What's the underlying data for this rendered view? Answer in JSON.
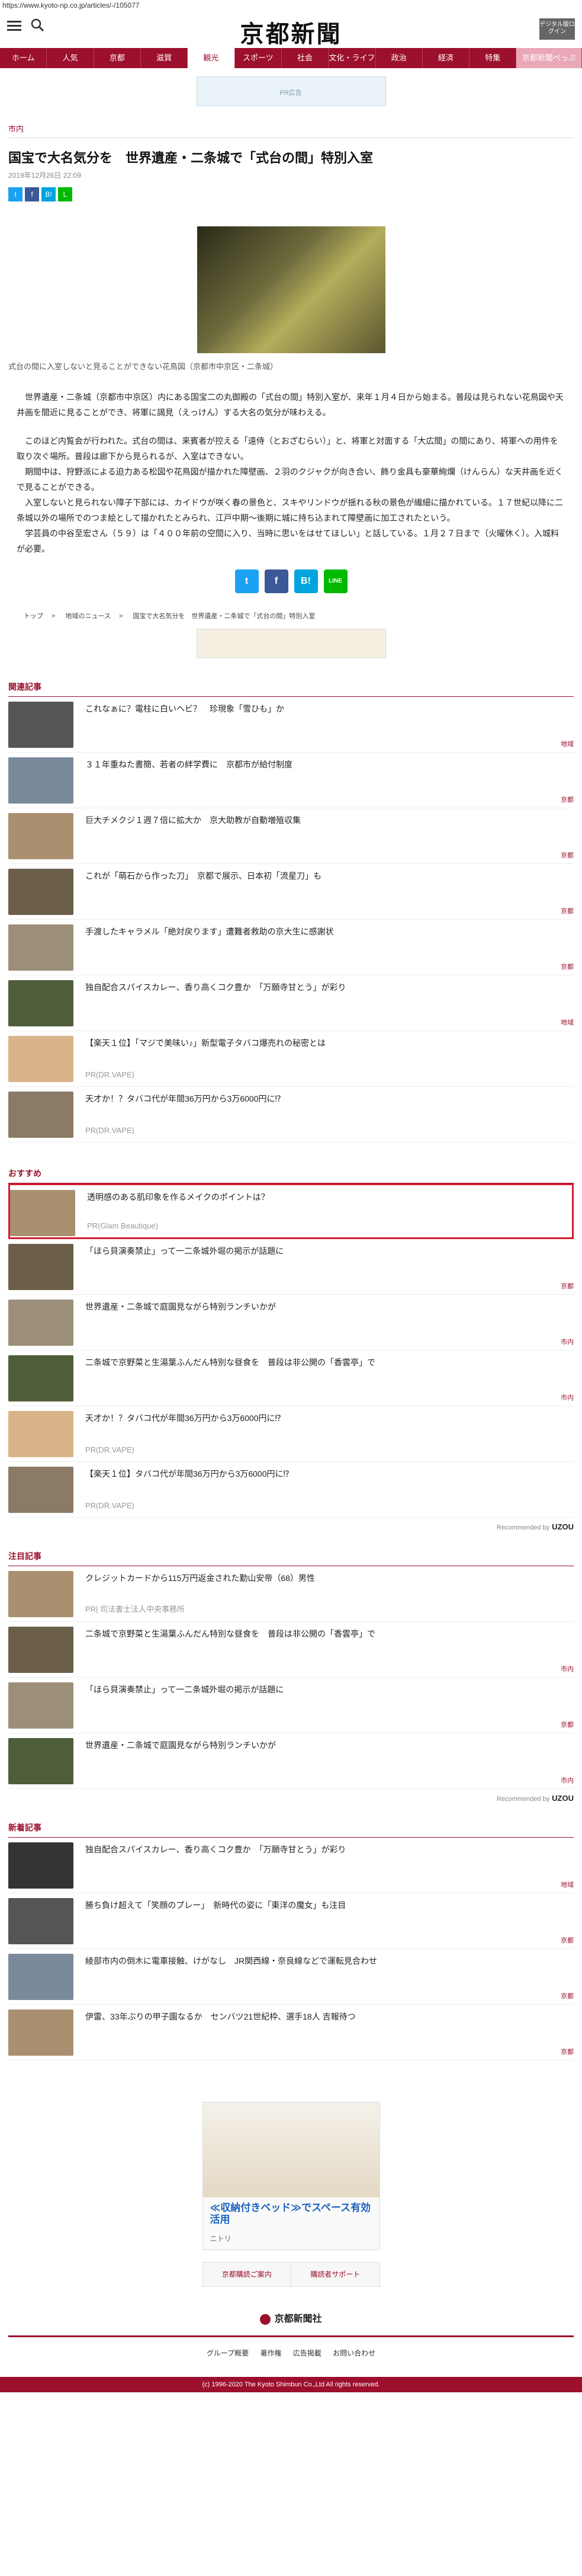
{
  "url": "https://www.kyoto-np.co.jp/articles/-/105077",
  "site": {
    "logo_text": "京都新聞",
    "digital_btn": "デジタル版ログイン",
    "brand_color": "#9c0f2d"
  },
  "nav": [
    "ホーム",
    "人気",
    "京都",
    "滋賀",
    "観光",
    "スポーツ",
    "社会",
    "文化・ライフ",
    "政治",
    "経済",
    "特集",
    "京都新聞ぺっぷ"
  ],
  "nav_active": 4,
  "ad_top_text": "PR広告",
  "article": {
    "section": "市内",
    "title": "国宝で大名気分を　世界遺産・二条城で「式台の間」特別入室",
    "date": "2019年12月26日 22:09",
    "caption": "式台の間に入室しないと見ることができない花鳥図（京都市中京区・二条城）",
    "paragraphs": [
      "　世界遺産・二条城（京都市中京区）内にある国宝二の丸御殿の「式台の間」特別入室が、来年１月４日から始まる。普段は見られない花鳥図や天井画を間近に見ることができ、将軍に謁見（えっけん）する大名の気分が味わえる。",
      "　このほど内覧会が行われた。式台の間は、来賓者が控える「遠侍（とおざむらい）」と、将軍と対面する「大広間」の間にあり、将軍への用件を取り次ぐ場所。普段は廊下から見られるが、入室はできない。\n　期間中は、狩野派による迫力ある松図や花鳥図が描かれた障壁画、２羽のクジャクが向き合い、飾り金具も豪華絢爛（けんらん）な天井画を近くで見ることができる。\n　入室しないと見られない障子下部には、カイドウが咲く春の景色と、スキやリンドウが揺れる秋の景色が繊細に描かれている。１７世紀以降に二条城以外の場所でのつま絵として描かれたとみられ、江戸中期～後期に城に持ち込まれて障壁画に加工されたという。\n　学芸員の中谷至宏さん（５９）は「４００年前の空間に入り、当時に思いをはせてほしい」と話している。１月２７日まで（火曜休く）。入城料が必要。"
    ]
  },
  "share": {
    "twitter": "t",
    "facebook": "f",
    "hatena": "B!",
    "line": "LINE"
  },
  "breadcrumb": [
    "トップ",
    "地域のニュース",
    "国宝で大名気分を　世界遺産・二条城で「式台の間」特別入室"
  ],
  "related": {
    "title": "関連記事",
    "items": [
      {
        "title": "これなぁに？電柱に白いヘビ？　珍現象「雪ひも」か",
        "cat": "地域"
      },
      {
        "title": "３１年重ねた書簡、若者の絆学費に　京都市が給付制度",
        "cat": "京都"
      },
      {
        "title": "巨大チメクジ１週７倍に拡大か　京大助教が自動増殖収集",
        "cat": "京都"
      },
      {
        "title": "これが「萌石から作った刀」　京都で展示、日本初「流星刀」も",
        "cat": "京都"
      },
      {
        "title": "手渡したキャラメル「絶対戻ります」遭難者救助の京大生に感謝状",
        "cat": "京都"
      },
      {
        "title": "独自配合スパイスカレー、香り高くコク豊か　「万願寺甘とう」が彩り",
        "cat": "地域"
      },
      {
        "title": "【楽天１位】「マジで美味い♪」新型電子タバコ爆売れの秘密とは",
        "pr": "PR(DR.VAPE)"
      },
      {
        "title": "天才か！？タバコ代が年間36万円から3万6000円に⁉",
        "pr": "PR(DR.VAPE)"
      }
    ]
  },
  "recommend": {
    "title": "おすすめ",
    "items": [
      {
        "title": "透明感のある肌印象を作るメイクのポイントは？",
        "pr": "PR(Glam Beautique)"
      },
      {
        "title": "「ほら貝演奏禁止」って一二条城外堀の掲示が話題に",
        "cat": "京都"
      },
      {
        "title": "世界遺産・二条城で庭園見ながら特別ランチいかが",
        "cat": "市内"
      },
      {
        "title": "二条城で京野菜と生湯葉ふんだん特別な昼食を　普段は非公開の「香雲亭」で",
        "cat": "市内"
      },
      {
        "title": "天才か！？タバコ代が年間36万円から3万6000円に⁉",
        "pr": "PR(DR.VAPE)"
      },
      {
        "title": "【楽天１位】タバコ代が年間36万円から3万6000円に⁉",
        "pr": "PR(DR.VAPE)"
      }
    ],
    "by": "Recommended by",
    "by_brand": "UZOU"
  },
  "attention": {
    "title": "注目記事",
    "items": [
      {
        "title": "クレジットカードから115万円返金された勤山安帝（68）男性",
        "pr": "PR| 司法書士法人中央事務所"
      },
      {
        "title": "二条城で京野菜と生湯葉ふんだん特別な昼食を　普段は非公開の「香雲亭」で",
        "cat": "市内"
      },
      {
        "title": "「ほら貝演奏禁止」って一二条城外堀の掲示が話題に",
        "cat": "京都"
      },
      {
        "title": "世界遺産・二条城で庭園見ながら特別ランチいかが",
        "cat": "市内"
      }
    ],
    "by": "Recommended by",
    "by_brand": "UZOU"
  },
  "newest": {
    "title": "新着記事",
    "items": [
      {
        "title": "独自配合スパイスカレー、香り高くコク豊か　「万願寺甘とう」が彩り",
        "cat": "地域"
      },
      {
        "title": "勝ち負け超えて「笑顔のプレー」　新時代の姿に「東洋の魔女」も注目",
        "cat": "京都"
      },
      {
        "title": "綾部市内の倒木に電車接触、けがなし　JR関西線・奈良線などで運転見合わせ",
        "cat": "京都"
      },
      {
        "title": "伊雷、33年ぶりの甲子園なるか　センバツ21世紀枠、選手18人 吉報待つ",
        "cat": "京都"
      }
    ]
  },
  "ad_box": {
    "text": "≪収納付きベッド≫でスペース有効活用",
    "sub": "ニトリ"
  },
  "buttons": [
    "京都購読ご案内",
    "購読者サポート"
  ],
  "footer": {
    "logo": "京都新聞社",
    "links": [
      "グループ概要",
      "著作権",
      "広告掲載",
      "お問い合わせ"
    ],
    "copyright": "(c) 1996-2020 The Kyoto Shimbun Co.,Ltd All rights reserved."
  }
}
